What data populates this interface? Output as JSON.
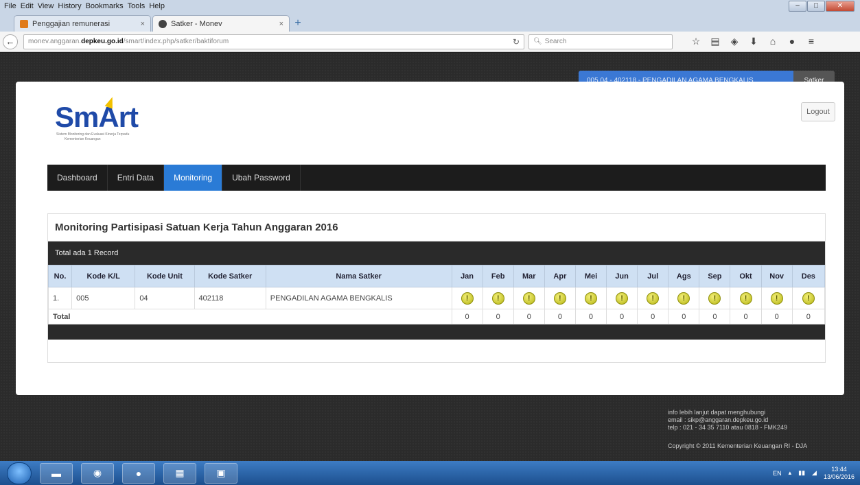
{
  "menubar": {
    "items": [
      "File",
      "Edit",
      "View",
      "History",
      "Bookmarks",
      "Tools",
      "Help"
    ]
  },
  "tabs": [
    {
      "label": "Penggajian remunerasi",
      "icon": "k-icon",
      "close": "×"
    },
    {
      "label": "Satker - Monev",
      "icon": "emblem-icon",
      "close": "×"
    }
  ],
  "newtab": "+",
  "address": {
    "prefix": "monev.anggaran.",
    "domain": "depkeu.go.id",
    "path": "/smart/index.php/satker/baktiforum",
    "search_placeholder": "Search"
  },
  "user": {
    "badge": "005 04 - 402118 - PENGADILAN AGAMA BENGKALIS",
    "role": "Satker",
    "logout": "Logout"
  },
  "logo": {
    "text_sm": "Sm",
    "text_a": "A",
    "text_rt": "rt",
    "tagline_1": "Sistem Monitoring dan Evaluasi Kinerja Terpadu",
    "tagline_2": "Kementerian Keuangan"
  },
  "nav": [
    {
      "label": "Dashboard",
      "active": false
    },
    {
      "label": "Entri Data",
      "active": false
    },
    {
      "label": "Monitoring",
      "active": true
    },
    {
      "label": "Ubah Password",
      "active": false
    }
  ],
  "panel": {
    "title": "Monitoring Partisipasi Satuan Kerja Tahun Anggaran 2016",
    "record_count": "Total ada 1 Record"
  },
  "table": {
    "headers": [
      "No.",
      "Kode K/L",
      "Kode Unit",
      "Kode Satker",
      "Nama Satker",
      "Jan",
      "Feb",
      "Mar",
      "Apr",
      "Mei",
      "Jun",
      "Jul",
      "Ags",
      "Sep",
      "Okt",
      "Nov",
      "Des"
    ],
    "rows": [
      {
        "no": "1.",
        "kode_kl": "005",
        "kode_unit": "04",
        "kode_satker": "402118",
        "nama": "PENGADILAN AGAMA BENGKALIS",
        "status_symbol": "!"
      }
    ],
    "total_label": "Total",
    "totals": [
      "0",
      "0",
      "0",
      "0",
      "0",
      "0",
      "0",
      "0",
      "0",
      "0",
      "0",
      "0"
    ]
  },
  "footer": {
    "info_1": "info lebih lanjut dapat menghubungi",
    "info_2": "email : sikp@anggaran.depkeu.go.id",
    "info_3": "telp : 021 - 34 35 7110 atau 0818 - FMK249",
    "copyright": "Copyright © 2011 Kementerian Keuangan RI - DJA"
  },
  "taskbar": {
    "lang": "EN",
    "time": "13:44",
    "date": "13/06/2016"
  },
  "colors": {
    "accent": "#2a7bd6",
    "nav_bg": "#1c1c1c",
    "header_bg": "#cfe0f3",
    "warn": "#d4d420"
  }
}
